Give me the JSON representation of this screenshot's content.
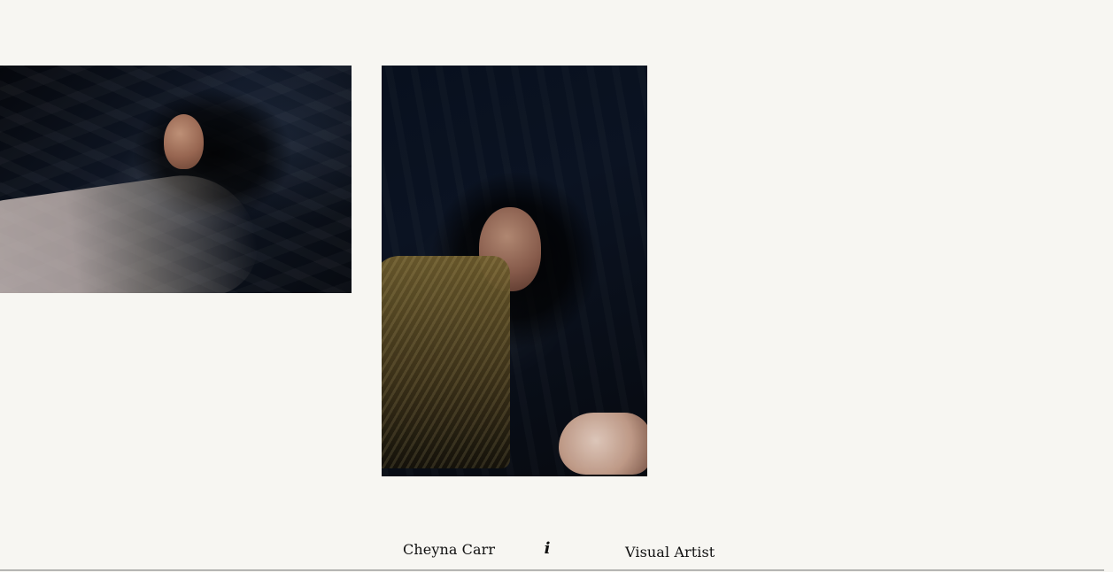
{
  "footer": {
    "name": "Cheyna Carr",
    "info_icon_glyph": "i",
    "role": "Visual Artist"
  },
  "icons": {
    "info": "info-icon"
  }
}
